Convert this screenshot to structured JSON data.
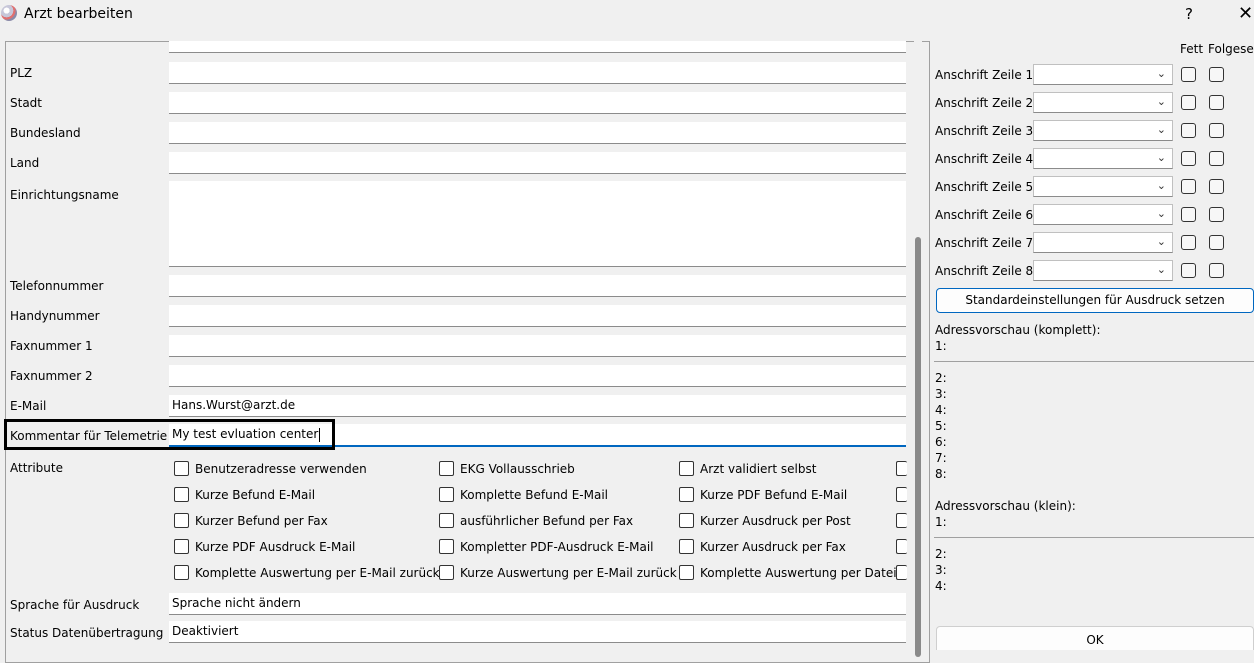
{
  "window": {
    "title": "Arzt bearbeiten",
    "help": "?",
    "close": "✕"
  },
  "form": {
    "plz_label": "PLZ",
    "stadt_label": "Stadt",
    "bundesland_label": "Bundesland",
    "land_label": "Land",
    "einrichtungsname_label": "Einrichtungsname",
    "telefon_label": "Telefonnummer",
    "handy_label": "Handynummer",
    "fax1_label": "Faxnummer 1",
    "fax2_label": "Faxnummer 2",
    "email_label": "E-Mail",
    "email_value": "Hans.Wurst@arzt.de",
    "kommentar_label": "Kommentar für Telemetrie",
    "kommentar_value": "My test evluation center",
    "attribute_label": "Attribute",
    "sprache_label": "Sprache für Ausdruck",
    "sprache_value": "Sprache nicht ändern",
    "status_label": "Status Datenübertragung",
    "status_value": "Deaktiviert"
  },
  "attributes": [
    "Benutzeradresse verwenden",
    "EKG Vollausschrieb",
    "Arzt validiert selbst",
    "Kurze Befund E-Mail",
    "Komplette Befund E-Mail",
    "Kurze PDF Befund E-Mail",
    "Kurzer Befund per Fax",
    "ausführlicher Befund per Fax",
    "Kurzer Ausdruck per Post",
    "Kurze PDF Ausdruck E-Mail",
    "Kompletter PDF-Ausdruck E-Mail",
    "Kurzer Ausdruck per Fax",
    "Komplette Auswertung per E-Mail zurück",
    "Kurze Auswertung per E-Mail zurück",
    "Komplette Auswertung per Datei"
  ],
  "print": {
    "fett_header": "Fett",
    "folge_header": "Folgesei",
    "rows": [
      "Anschrift Zeile 1",
      "Anschrift Zeile 2",
      "Anschrift Zeile 3",
      "Anschrift Zeile 4",
      "Anschrift Zeile 5",
      "Anschrift Zeile 6",
      "Anschrift Zeile 7",
      "Anschrift Zeile 8"
    ],
    "default_button": "Standardeinstellungen für Ausdruck setzen"
  },
  "preview": {
    "full_label": "Adressvorschau (komplett):",
    "full_lines": [
      "1:",
      "2:",
      "3:",
      "4:",
      "5:",
      "6:",
      "7:",
      "8:"
    ],
    "small_label": "Adressvorschau (klein):",
    "small_lines": [
      "1:",
      "2:",
      "3:",
      "4:"
    ]
  },
  "ok_button": "OK"
}
